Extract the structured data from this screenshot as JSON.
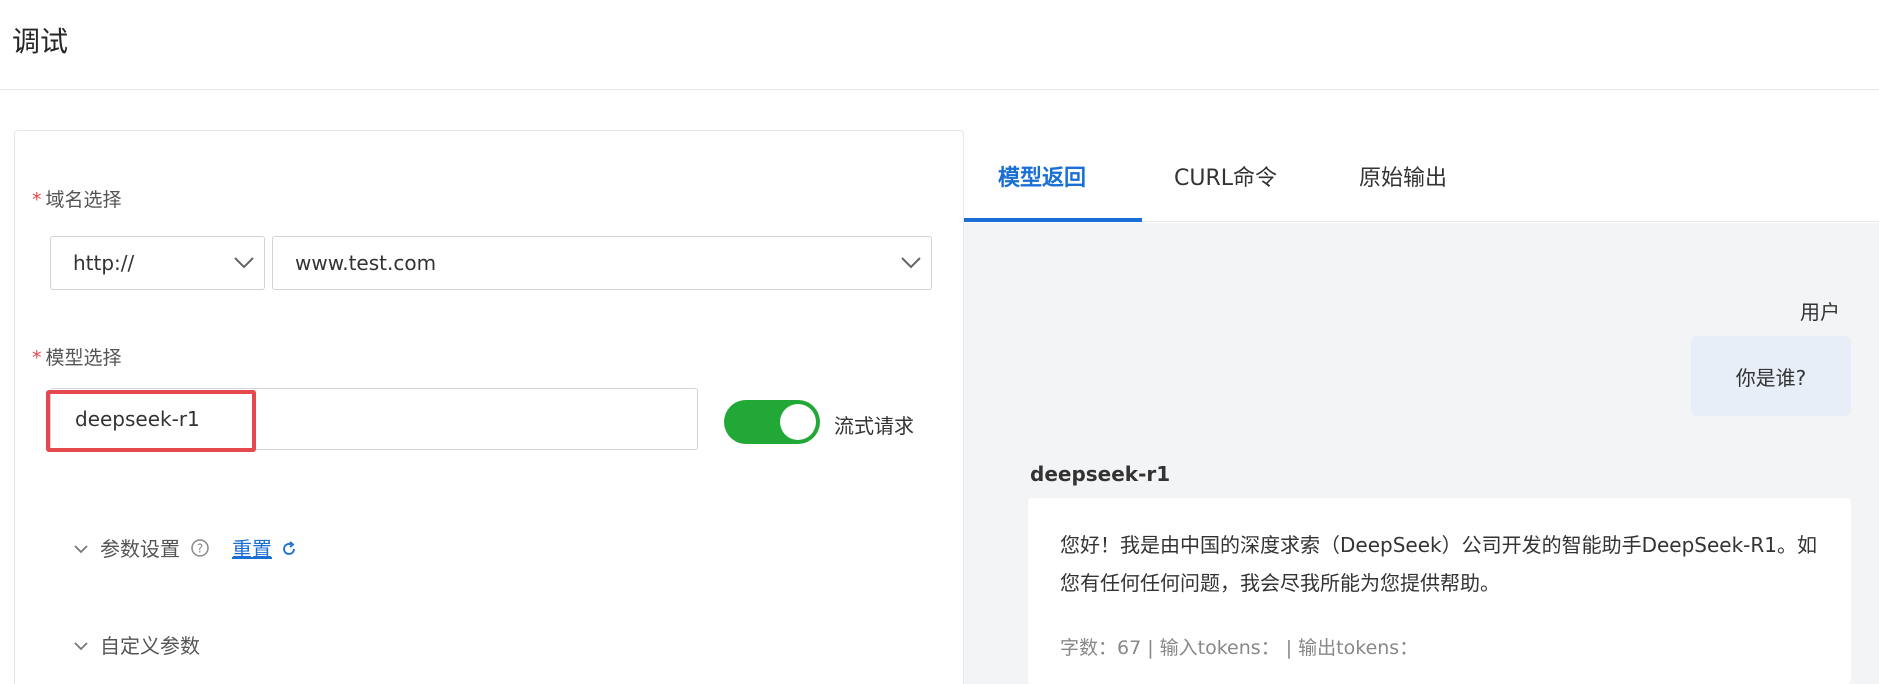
{
  "header": {
    "title": "调试"
  },
  "form": {
    "domain_label": "域名选择",
    "protocol_value": "http://",
    "domain_value": "www.test.com",
    "model_label": "模型选择",
    "model_value": "deepseek-r1",
    "stream_label": "流式请求",
    "stream_enabled": true,
    "params_label": "参数设置",
    "reset_label": "重置",
    "custom_label": "自定义参数"
  },
  "tabs": [
    {
      "label": "模型返回",
      "active": true
    },
    {
      "label": "CURL命令",
      "active": false
    },
    {
      "label": "原始输出",
      "active": false
    }
  ],
  "chat": {
    "user_name": "用户",
    "user_message": "你是谁?",
    "model_name": "deepseek-r1",
    "reply": "您好！我是由中国的深度求索（DeepSeek）公司开发的智能助手DeepSeek-R1。如您有任何任何问题，我会尽我所能为您提供帮助。",
    "stats": "字数：67 | 输入tokens：  | 输出tokens："
  },
  "colors": {
    "accent": "#1a6fd6",
    "toggle_on": "#22a836",
    "highlight": "#e5484d",
    "required": "#e5484d"
  },
  "icons": [
    "chevron-down-icon",
    "help-circle-icon",
    "refresh-icon"
  ]
}
